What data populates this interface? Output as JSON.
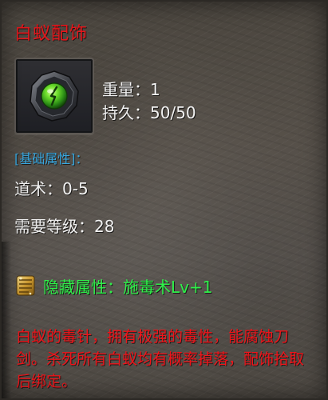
{
  "item": {
    "name": "白蚁配饰",
    "icon": "green-poison-gem-amulet-icon",
    "weight_label": "重量",
    "weight_value": "1",
    "durability_label": "持久",
    "durability_value": "50/50"
  },
  "base_attributes": {
    "header": "[基础属性]：",
    "taoism_label": "道术",
    "taoism_value": "0-5",
    "required_level_label": "需要等级",
    "required_level_value": "28"
  },
  "hidden_attribute": {
    "icon": "gold-scroll-icon",
    "text": "隐藏属性：施毒术Lv+1"
  },
  "description": "白蚁的毒针，拥有极强的毒性，能腐蚀刀剑。杀死所有白蚁均有概率掉落，配饰拾取后绑定。",
  "colors": {
    "title_red": "#e6161b",
    "header_blue": "#39a8e0",
    "hidden_green": "#2ff04a",
    "description_red": "#f0141a",
    "text_white": "#f2f2f2"
  }
}
